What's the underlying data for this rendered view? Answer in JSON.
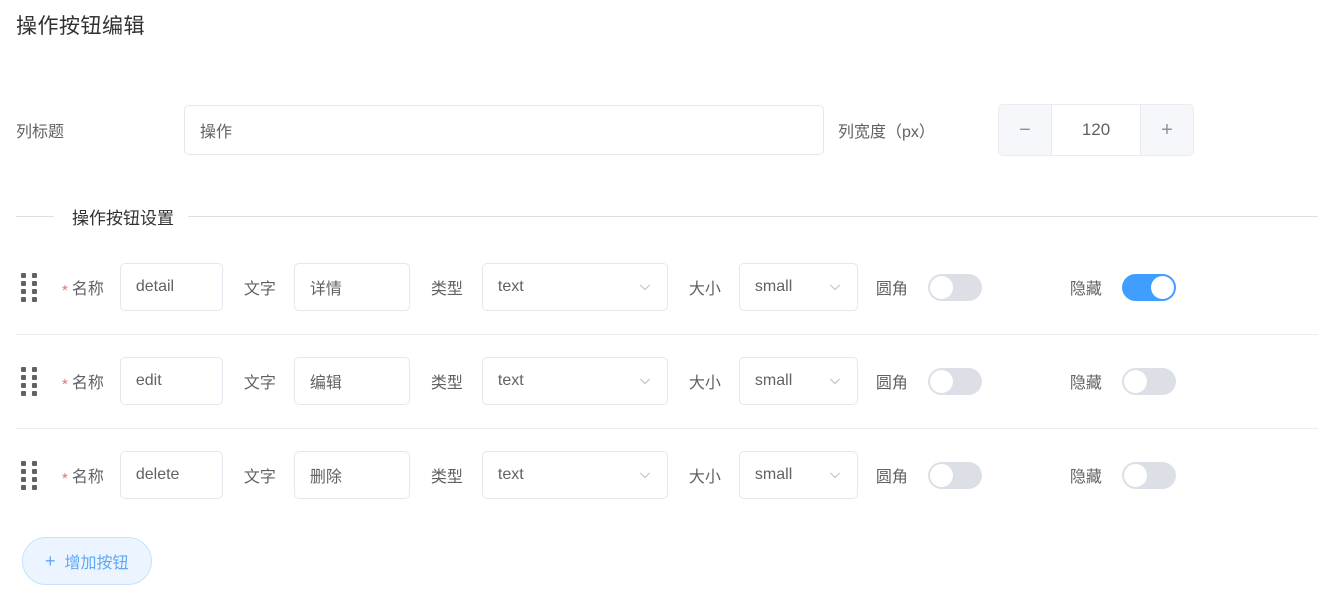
{
  "page": {
    "title": "操作按钮编辑"
  },
  "top_form": {
    "column_title_label": "列标题",
    "column_title_value": "操作",
    "column_width_label": "列宽度（px）",
    "column_width_value": "120",
    "stepper_minus": "−",
    "stepper_plus": "+"
  },
  "section": {
    "divider_title": "操作按钮设置"
  },
  "row_labels": {
    "name": "名称",
    "text": "文字",
    "type": "类型",
    "size": "大小",
    "round": "圆角",
    "hidden": "隐藏",
    "required_mark": "*"
  },
  "buttons": [
    {
      "name": "detail",
      "text": "详情",
      "type": "text",
      "size": "small",
      "round": false,
      "hidden": true
    },
    {
      "name": "edit",
      "text": "编辑",
      "type": "text",
      "size": "small",
      "round": false,
      "hidden": false
    },
    {
      "name": "delete",
      "text": "删除",
      "type": "text",
      "size": "small",
      "round": false,
      "hidden": false
    }
  ],
  "footer": {
    "add_button_label": "增加按钮",
    "add_button_icon": "plus-icon"
  },
  "colors": {
    "accent": "#409eff",
    "switch_off": "#dcdfe6",
    "required": "#f56c6c",
    "border": "#e4e7ed",
    "add_button_bg": "#ecf5ff",
    "add_button_border": "#c6e2ff",
    "add_button_text": "#5fa8f5"
  }
}
